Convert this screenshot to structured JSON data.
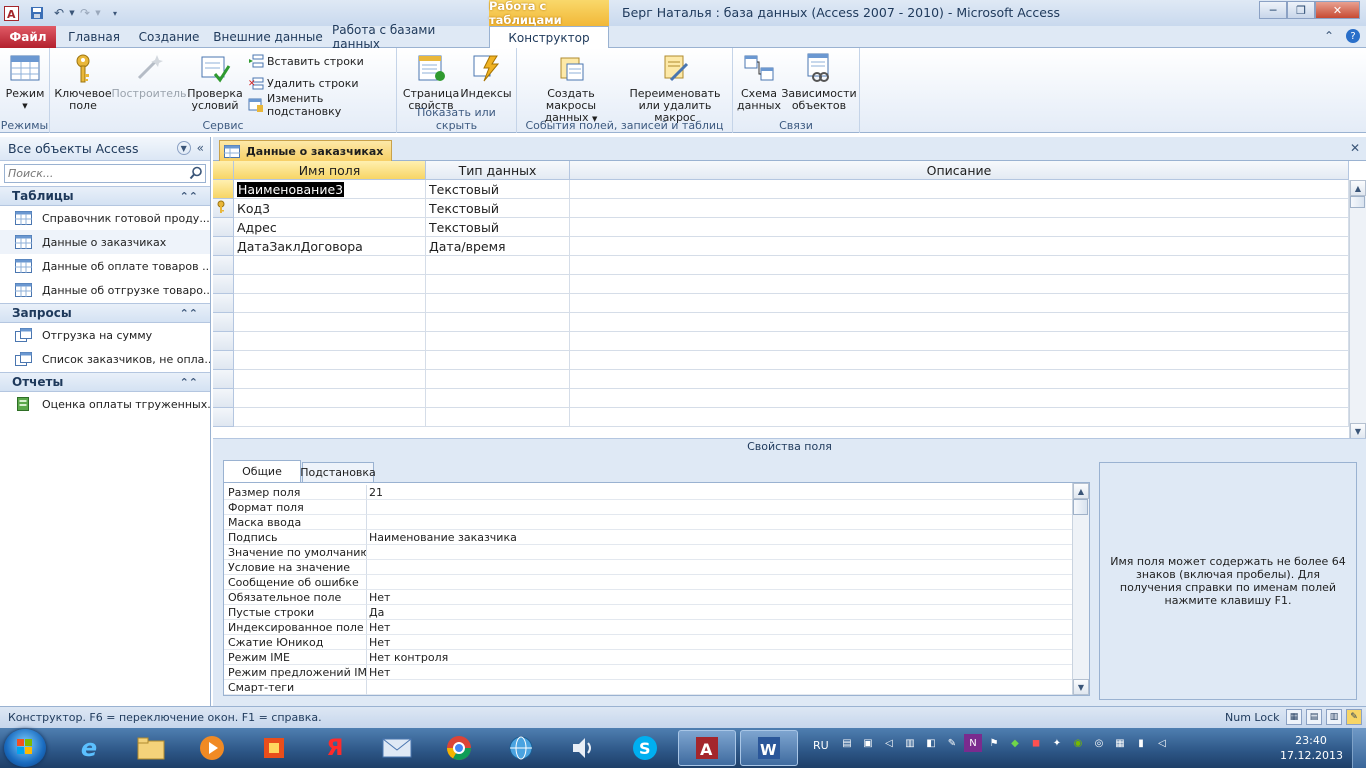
{
  "window": {
    "title": "Берг Наталья : база данных (Access 2007 - 2010)  -  Microsoft Access",
    "context_header": "Работа с таблицами"
  },
  "tabs": [
    {
      "label": "Файл"
    },
    {
      "label": "Главная"
    },
    {
      "label": "Создание"
    },
    {
      "label": "Внешние данные"
    },
    {
      "label": "Работа с базами данных"
    },
    {
      "label": "Конструктор"
    }
  ],
  "ribbon": {
    "groups": {
      "modes": "Режимы",
      "service": "Сервис",
      "showhide": "Показать или скрыть",
      "events": "События полей, записей и таблиц",
      "relations": "Связи"
    },
    "buttons": {
      "mode": "Режим",
      "key_field_1": "Ключевое",
      "key_field_2": "поле",
      "builder": "Построитель",
      "check_1": "Проверка",
      "check_2": "условий",
      "insert_rows": "Вставить строки",
      "delete_rows": "Удалить строки",
      "modify_lookup": "Изменить подстановку",
      "prop_sheet_1": "Страница",
      "prop_sheet_2": "свойств",
      "indexes": "Индексы",
      "create_macros_1": "Создать макросы",
      "create_macros_2": "данных",
      "rename_macro_1": "Переименовать",
      "rename_macro_2": "или удалить макрос",
      "schema_1": "Схема",
      "schema_2": "данных",
      "deps_1": "Зависимости",
      "deps_2": "объектов"
    }
  },
  "nav": {
    "title": "Все объекты Access",
    "search_placeholder": "Поиск...",
    "sections": [
      {
        "title": "Таблицы",
        "items": [
          "Справочник готовой проду...",
          "Данные о заказчиках",
          "Данные об оплате товаров ...",
          "Данные об отгрузке товаро..."
        ]
      },
      {
        "title": "Запросы",
        "items": [
          "Отгрузка на сумму",
          "Список заказчиков, не опла..."
        ]
      },
      {
        "title": "Отчеты",
        "items": [
          "Оценка оплаты тгруженных..."
        ]
      }
    ]
  },
  "document": {
    "tab_title": "Данные о заказчиках",
    "columns": [
      "Имя поля",
      "Тип данных",
      "Описание"
    ],
    "rows": [
      {
        "name": "Наименование3",
        "type": "Текстовый",
        "desc": ""
      },
      {
        "name": "Код3",
        "type": "Текстовый",
        "desc": ""
      },
      {
        "name": "Адрес",
        "type": "Текстовый",
        "desc": ""
      },
      {
        "name": "ДатаЗаклДоговора",
        "type": "Дата/время",
        "desc": ""
      }
    ]
  },
  "properties": {
    "bar_label": "Свойства поля",
    "tabs": [
      "Общие",
      "Подстановка"
    ],
    "rows": [
      {
        "name": "Размер поля",
        "value": "21"
      },
      {
        "name": "Формат поля",
        "value": ""
      },
      {
        "name": "Маска ввода",
        "value": ""
      },
      {
        "name": "Подпись",
        "value": "Наименование заказчика"
      },
      {
        "name": "Значение по умолчанию",
        "value": ""
      },
      {
        "name": "Условие на значение",
        "value": ""
      },
      {
        "name": "Сообщение об ошибке",
        "value": ""
      },
      {
        "name": "Обязательное поле",
        "value": "Нет"
      },
      {
        "name": "Пустые строки",
        "value": "Да"
      },
      {
        "name": "Индексированное поле",
        "value": "Нет"
      },
      {
        "name": "Сжатие Юникод",
        "value": "Нет"
      },
      {
        "name": "Режим IME",
        "value": "Нет контроля"
      },
      {
        "name": "Режим предложений IME",
        "value": "Нет"
      },
      {
        "name": "Смарт-теги",
        "value": ""
      }
    ],
    "help_text": "Имя поля может содержать не более 64 знаков (включая пробелы). Для получения справки по именам полей нажмите клавишу F1."
  },
  "status": {
    "text": "Конструктор.  F6 = переключение окон.  F1 = справка.",
    "numlock": "Num Lock"
  },
  "taskbar": {
    "lang": "RU",
    "time": "23:40",
    "date": "17.12.2013"
  },
  "colors": {
    "accent": "#f7d565",
    "file_tab": "#b3202d",
    "ribbon_border": "#9ab2d1"
  }
}
